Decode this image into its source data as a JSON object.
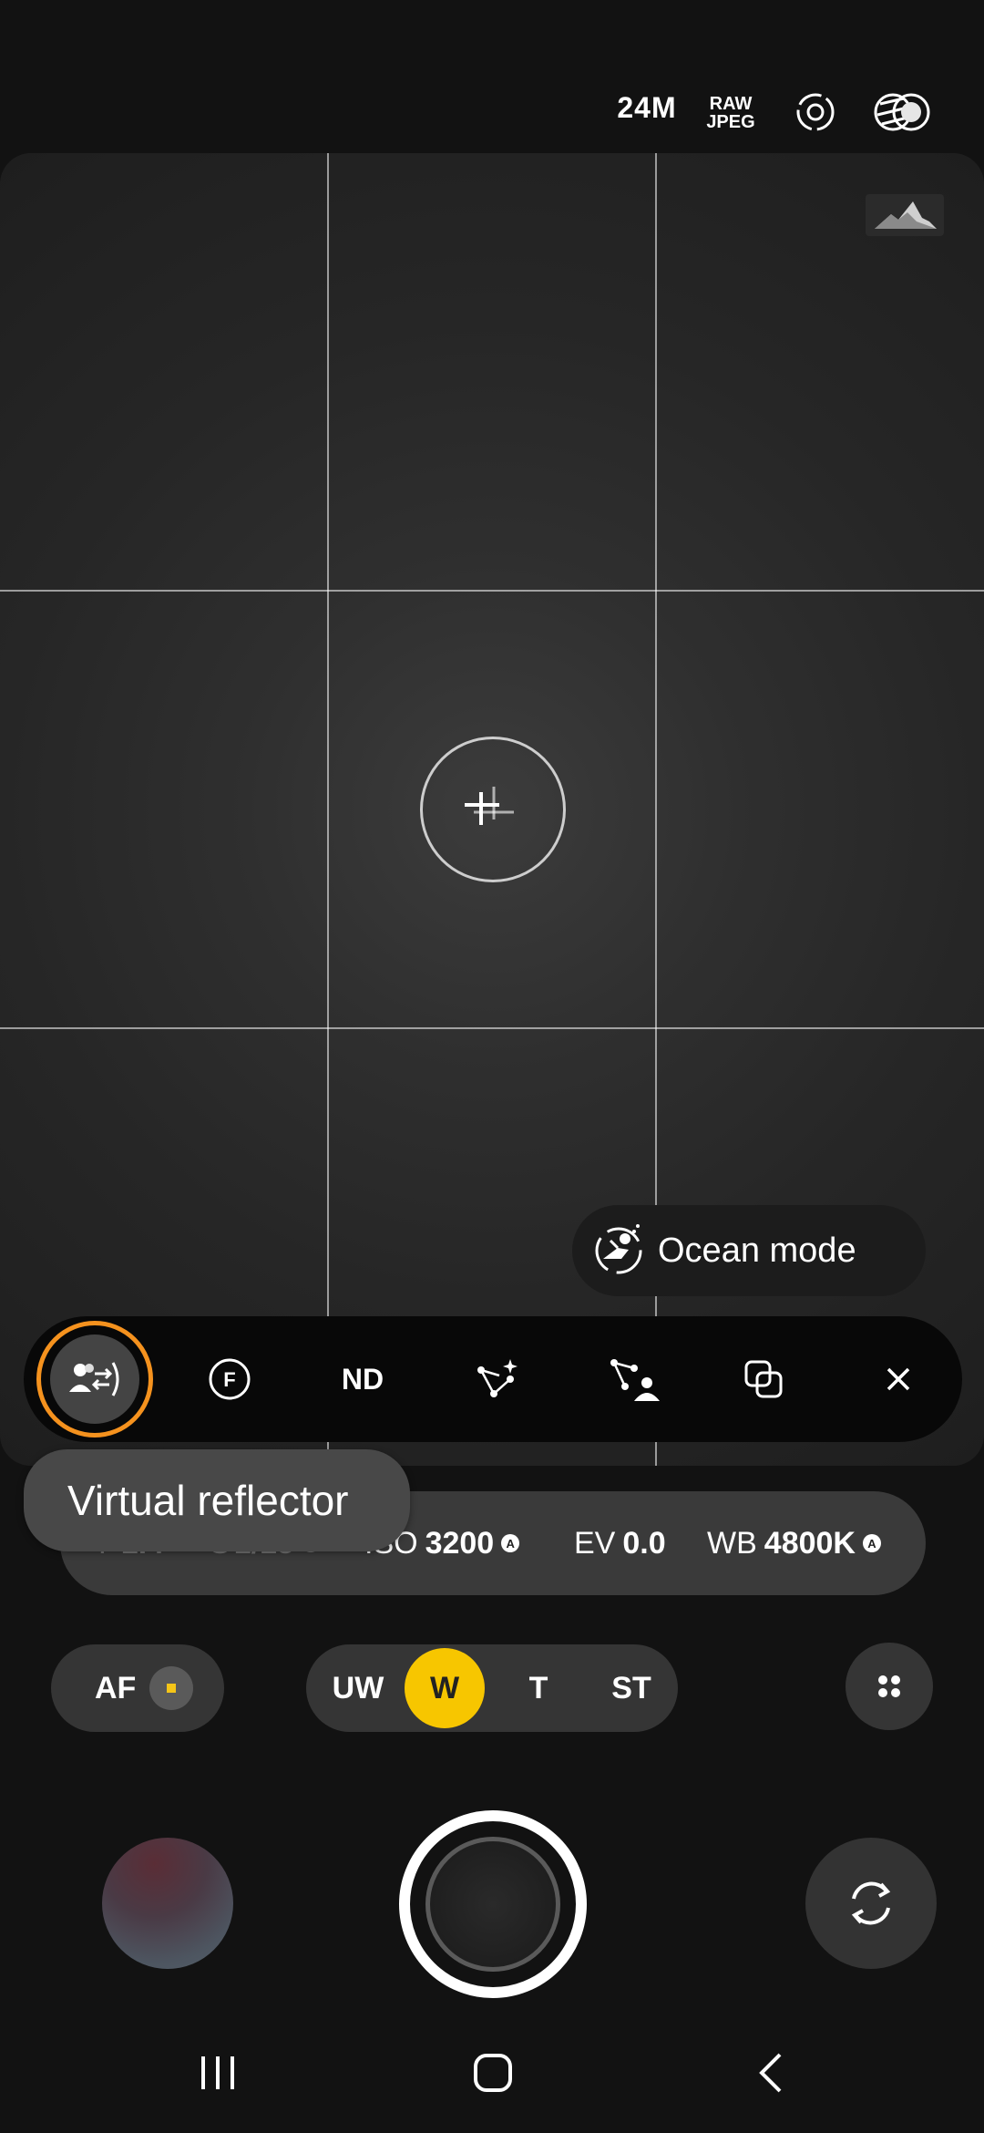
{
  "top_bar": {
    "resolution": "24M",
    "format_line1": "RAW",
    "format_line2": "JPEG",
    "icons": [
      "motion-photo-icon",
      "filter-icon"
    ]
  },
  "viewfinder": {
    "histogram_icon": "histogram-icon",
    "focus_icon": "focus-crosshair-icon"
  },
  "ocean_mode": {
    "label": "Ocean mode",
    "icon": "diver-icon"
  },
  "pro_toolbar": {
    "items": [
      "virtual-reflector-icon",
      "filter-f-icon",
      "ND",
      "star-effect-icon",
      "portrait-effect-icon",
      "layers-icon",
      "close-icon"
    ]
  },
  "tooltip": {
    "text": "Virtual reflector"
  },
  "settings": {
    "aperture_label": "F",
    "aperture_value": "1.4",
    "shutter_label": "S",
    "shutter_value": "1/15",
    "iso_label": "ISO",
    "iso_value": "3200",
    "ev_label": "EV",
    "ev_value": "0.0",
    "wb_label": "WB",
    "wb_value": "4800K",
    "auto_badge": "A"
  },
  "focus": {
    "af_label": "AF"
  },
  "lenses": {
    "items": [
      "UW",
      "W",
      "T",
      "ST"
    ],
    "active": "W"
  },
  "colors": {
    "accent_orange": "#f5921e",
    "lens_active": "#f7c600"
  }
}
